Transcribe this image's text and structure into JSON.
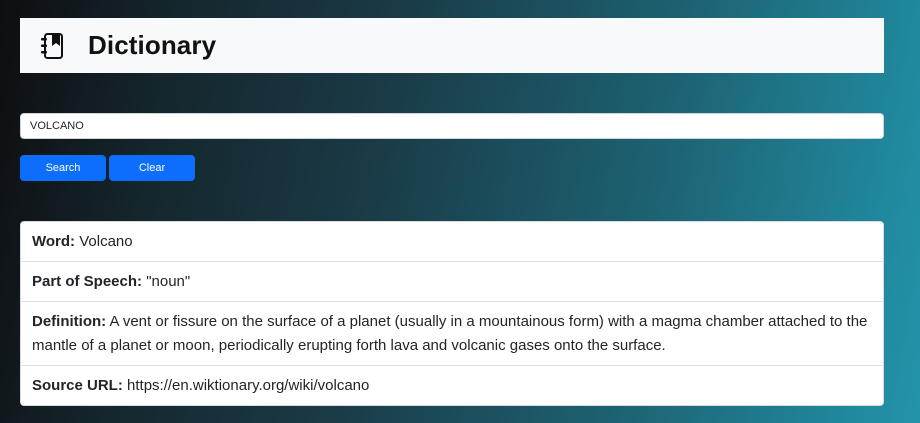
{
  "header": {
    "title": "Dictionary",
    "icon": "address-book-icon"
  },
  "search": {
    "value": "VOLCANO",
    "search_label": "Search",
    "clear_label": "Clear"
  },
  "result": {
    "word_label": "Word:",
    "word_value": "Volcano",
    "pos_label": "Part of Speech:",
    "pos_value": "\"noun\"",
    "definition_label": "Definition:",
    "definition_value": "A vent or fissure on the surface of a planet (usually in a mountainous form) with a magma chamber attached to the mantle of a planet or moon, periodically erupting forth lava and volcanic gases onto the surface.",
    "source_label": "Source URL:",
    "source_value": "https://en.wiktionary.org/wiki/volcano"
  },
  "colors": {
    "button": "#0d6efd",
    "header_bg": "#f8f9fa"
  }
}
